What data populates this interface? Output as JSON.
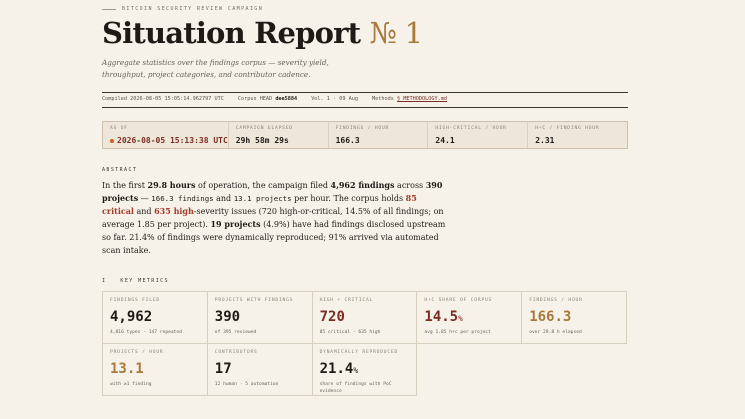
{
  "kicker": "Bitcoin Security Review Campaign",
  "title": {
    "main": "Situation Report",
    "number": "№ 1"
  },
  "subtitle": "Aggregate statistics over the findings corpus — severity yield, throughput, project categories, and contributor cadence.",
  "meta": {
    "compiled_label": "Compiled",
    "compiled_value": "2026-08-05 15:05:14.962797 UTC",
    "corpus_label": "Corpus HEAD",
    "corpus_value": "dee5884",
    "vol": "Vol. 1 · 09 Aug",
    "methods_label": "Methods",
    "methods_link": "§ METHODOLOGY.md"
  },
  "statbar": [
    {
      "label": "As Of",
      "value": "2026-08-05 15:13:38 UTC",
      "live": true
    },
    {
      "label": "Campaign Elapsed",
      "value": "29h 58m 29s"
    },
    {
      "label": "Findings / Hour",
      "value": "166.3"
    },
    {
      "label": "High-Critical / Hour",
      "value": "24.1"
    },
    {
      "label": "H+C / Finding Hour",
      "value": "2.31"
    }
  ],
  "abstract": {
    "label": "Abstract",
    "t1": "In the first ",
    "hours": "29.8 hours",
    "t2": " of operation, the campaign filed ",
    "findings": "4,962 findings",
    "t3": " across ",
    "projects": "390 projects",
    "t4": " — ",
    "rate_findings": "166.3 findings",
    "t5": " and ",
    "rate_projects": "13.1 projects",
    "t6": " per hour. The corpus holds ",
    "critical": "85 critical",
    "t7": " and ",
    "high": "635 high",
    "t8": "-severity issues (720 high-or-critical, 14.5% of all findings; on average 1.85 per project). ",
    "disclosed": "19 projects",
    "t9": " (4.9%) have had findings disclosed upstream so far. 21.4% of findings were dynamically reproduced; 91% arrived via automated scan intake."
  },
  "metrics_section": {
    "num": "I",
    "label": "Key Metrics"
  },
  "metrics": [
    {
      "label": "Findings Filed",
      "value": "4,962",
      "unit": "",
      "sub": "4,816 types · 147 repeated",
      "tone": ""
    },
    {
      "label": "Projects with Findings",
      "value": "390",
      "unit": "",
      "sub": "of 395 reviewed",
      "tone": ""
    },
    {
      "label": "High + Critical",
      "value": "720",
      "unit": "",
      "sub": "85 critical · 635 high",
      "tone": "red"
    },
    {
      "label": "H+C Share of Corpus",
      "value": "14.5",
      "unit": "%",
      "sub": "avg 1.85 h+c per project",
      "tone": "red"
    },
    {
      "label": "Findings / Hour",
      "value": "166.3",
      "unit": "",
      "sub": "over 29.8 h elapsed",
      "tone": "gold"
    },
    {
      "label": "Projects / Hour",
      "value": "13.1",
      "unit": "",
      "sub": "with ≥1 finding",
      "tone": "gold"
    },
    {
      "label": "Contributors",
      "value": "17",
      "unit": "",
      "sub": "12 human · 5 automation",
      "tone": ""
    },
    {
      "label": "Dynamically Reproduced",
      "value": "21.4",
      "unit": "%",
      "sub": "share of findings with PoC evidence",
      "tone": ""
    }
  ]
}
